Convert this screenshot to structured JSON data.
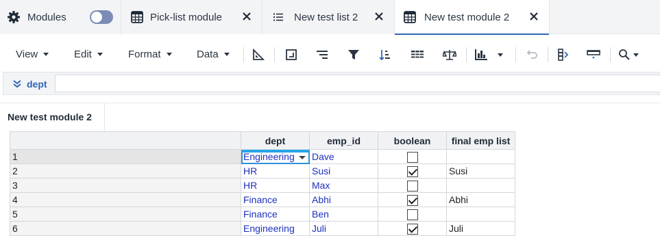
{
  "tabs": {
    "modules": {
      "label": "Modules",
      "toggle_on": false
    },
    "pick_list": {
      "label": "Pick-list module"
    },
    "test_list": {
      "label": "New test list 2"
    },
    "test_module": {
      "label": "New test module 2",
      "active": true
    }
  },
  "toolbar": {
    "menus": [
      "View",
      "Edit",
      "Format",
      "Data"
    ],
    "icons": [
      "triangle-ruler-icon",
      "insert-chart-icon",
      "align-right-lines-icon",
      "filter-icon",
      "sort-icon",
      "grid-icon",
      "balance-scale-icon",
      "bar-chart-icon",
      "undo-icon",
      "column-split-icon",
      "row-insert-icon",
      "search-icon"
    ]
  },
  "formula_bar": {
    "name": "dept",
    "value": ""
  },
  "section": {
    "title": "New test module 2"
  },
  "grid": {
    "columns": [
      "dept",
      "emp_id",
      "boolean",
      "final emp list"
    ],
    "rows": [
      {
        "num": "1",
        "dept": "Engineering",
        "emp_id": "Dave",
        "boolean": false,
        "final": ""
      },
      {
        "num": "2",
        "dept": "HR",
        "emp_id": "Susi",
        "boolean": true,
        "final": "Susi"
      },
      {
        "num": "3",
        "dept": "HR",
        "emp_id": "Max",
        "boolean": false,
        "final": ""
      },
      {
        "num": "4",
        "dept": "Finance",
        "emp_id": "Abhi",
        "boolean": true,
        "final": "Abhi"
      },
      {
        "num": "5",
        "dept": "Finance",
        "emp_id": "Ben",
        "boolean": false,
        "final": ""
      },
      {
        "num": "6",
        "dept": "Engineering",
        "emp_id": "Juli",
        "boolean": true,
        "final": "Juli"
      }
    ]
  },
  "colors": {
    "accent": "#2f66b5",
    "link": "#1d2fbd",
    "active_cell": "#25a4e8"
  }
}
